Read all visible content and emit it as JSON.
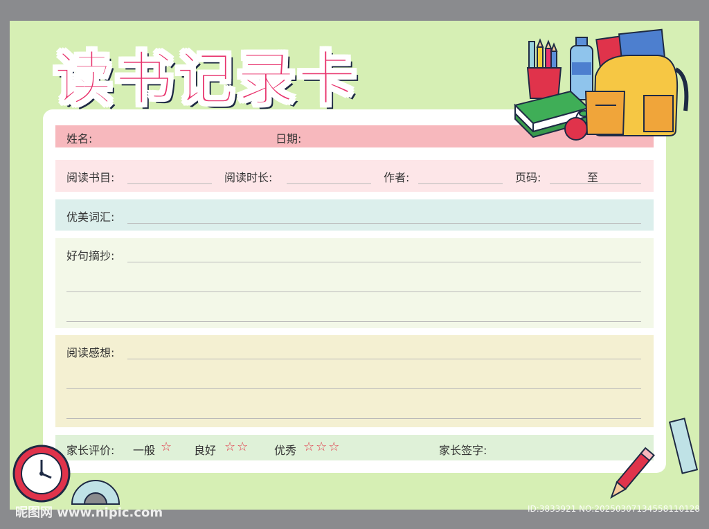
{
  "title": [
    "读",
    "书",
    "记",
    "录",
    "卡"
  ],
  "fields": {
    "name": "姓名:",
    "date": "日期:",
    "book": "阅读书目:",
    "duration": "阅读时长:",
    "author": "作者:",
    "pages": "页码:",
    "pages_to": "至",
    "vocab": "优美词汇:",
    "sentences": "好句摘抄:",
    "thoughts": "阅读感想:"
  },
  "rating": {
    "label": "家长评价:",
    "level1": "一般",
    "level1_stars": "☆",
    "level2": "良好",
    "level2_stars": "☆☆",
    "level3": "优秀",
    "level3_stars": "☆☆☆",
    "signature": "家长签字:"
  },
  "watermark": {
    "left": "昵图网 www.nipic.com",
    "right": "ID:3833921 NO:20250307134558110128"
  },
  "icons": [
    "pencil-cup-icon",
    "water-bottle-icon",
    "books-icon",
    "apple-icon",
    "backpack-icon",
    "clock-icon",
    "protractor-icon",
    "ruler-icon",
    "pencil-icon"
  ],
  "colors": {
    "title": "#e8336d",
    "background": "#d6efb4",
    "row_name": "#f7b8bd",
    "row_book": "#fde6e8",
    "row_vocab": "#dcefec",
    "row_sentences": "#f3f8e8",
    "row_thoughts": "#f4f0d2",
    "row_rating": "#dff1d8",
    "stars": "#e23a4a"
  }
}
